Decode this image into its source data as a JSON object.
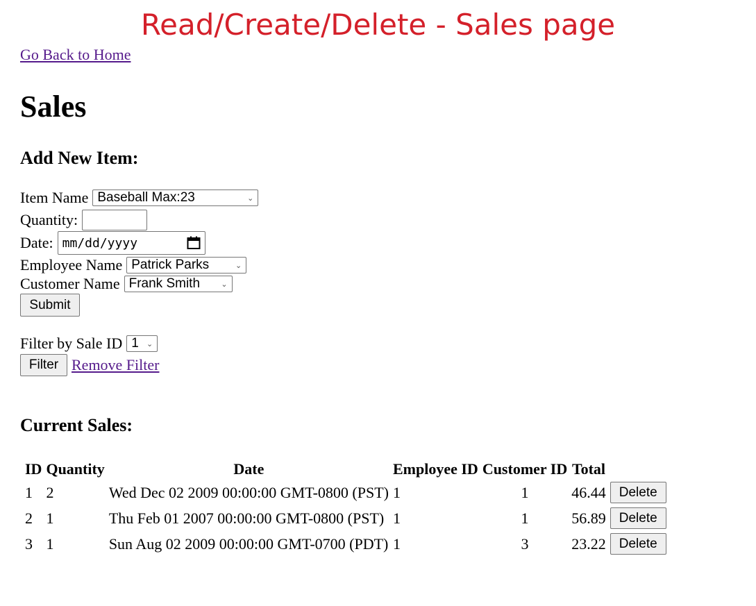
{
  "banner": "Read/Create/Delete - Sales page",
  "home_link": "Go Back to Home",
  "page_title": "Sales",
  "add_form": {
    "heading": "Add New Item:",
    "item_name_label": "Item Name",
    "item_name_value": "Baseball Max:23",
    "quantity_label": "Quantity:",
    "quantity_value": "",
    "date_label": "Date:",
    "date_placeholder": "mm/dd/yyyy",
    "employee_label": "Employee Name",
    "employee_value": "Patrick Parks",
    "customer_label": "Customer Name",
    "customer_value": "Frank Smith",
    "submit_label": "Submit"
  },
  "filter": {
    "label": "Filter by Sale ID",
    "value": "1",
    "button_label": "Filter",
    "remove_link": "Remove Filter"
  },
  "current_sales": {
    "heading": "Current Sales:",
    "columns": [
      "ID",
      "Quantity",
      "Date",
      "Employee ID",
      "Customer ID",
      "Total"
    ],
    "rows": [
      {
        "id": "1",
        "quantity": "2",
        "date": "Wed Dec 02 2009 00:00:00 GMT-0800 (PST)",
        "employee_id": "1",
        "customer_id": "1",
        "total": "46.44",
        "delete_label": "Delete"
      },
      {
        "id": "2",
        "quantity": "1",
        "date": "Thu Feb 01 2007 00:00:00 GMT-0800 (PST)",
        "employee_id": "1",
        "customer_id": "1",
        "total": "56.89",
        "delete_label": "Delete"
      },
      {
        "id": "3",
        "quantity": "1",
        "date": "Sun Aug 02 2009 00:00:00 GMT-0700 (PDT)",
        "employee_id": "1",
        "customer_id": "3",
        "total": "23.22",
        "delete_label": "Delete"
      }
    ]
  },
  "colors": {
    "banner": "#d4202a",
    "link": "#551a8b"
  }
}
